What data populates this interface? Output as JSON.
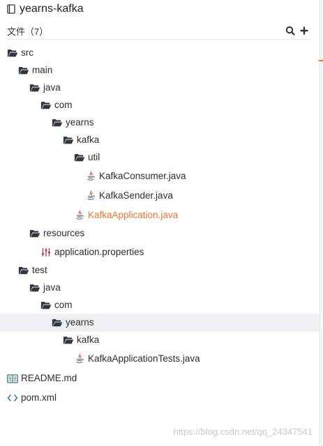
{
  "repo": {
    "title": "yearns-kafka",
    "icon": "repo-icon"
  },
  "files_header": {
    "label": "文件（7）",
    "search_icon": "search-icon",
    "add_icon": "plus-icon"
  },
  "tree": [
    {
      "name": "src",
      "type": "folder",
      "depth": 0
    },
    {
      "name": "main",
      "type": "folder",
      "depth": 1
    },
    {
      "name": "java",
      "type": "folder",
      "depth": 2
    },
    {
      "name": "com",
      "type": "folder",
      "depth": 3
    },
    {
      "name": "yearns",
      "type": "folder",
      "depth": 4
    },
    {
      "name": "kafka",
      "type": "folder",
      "depth": 5
    },
    {
      "name": "util",
      "type": "folder",
      "depth": 6
    },
    {
      "name": "KafkaConsumer.java",
      "type": "java",
      "depth": 7
    },
    {
      "name": "KafkaSender.java",
      "type": "java",
      "depth": 7
    },
    {
      "name": "KafkaApplication.java",
      "type": "java",
      "depth": 6,
      "state": "active"
    },
    {
      "name": "resources",
      "type": "folder",
      "depth": 2
    },
    {
      "name": "application.properties",
      "type": "properties",
      "depth": 3
    },
    {
      "name": "test",
      "type": "folder",
      "depth": 1
    },
    {
      "name": "java",
      "type": "folder",
      "depth": 2
    },
    {
      "name": "com",
      "type": "folder",
      "depth": 3
    },
    {
      "name": "yearns",
      "type": "folder",
      "depth": 4,
      "state": "selected"
    },
    {
      "name": "kafka",
      "type": "folder",
      "depth": 5
    },
    {
      "name": "KafkaApplicationTests.java",
      "type": "java",
      "depth": 6
    },
    {
      "name": "README.md",
      "type": "markdown",
      "depth": 0
    },
    {
      "name": "pom.xml",
      "type": "xml",
      "depth": 0
    }
  ],
  "colors": {
    "active_file": "#f0732b",
    "selected_row_bg": "#eef0f4",
    "java_icon": "#b07219",
    "folder_icon": "#2f3640"
  },
  "watermark": "https://blog.csdn.net/qq_24347541"
}
